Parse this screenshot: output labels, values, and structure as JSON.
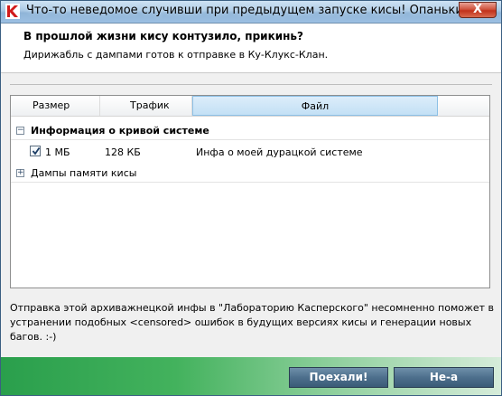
{
  "window": {
    "title": "Что-то неведомое случивши при предыдущем запуске кисы! Опаньки!",
    "close_label": "X"
  },
  "header": {
    "title": "В прошлой жизни кису контузило, прикинь?",
    "subtitle": "Дирижабль с дампами готов к отправке в Ку-Клукс-Клан."
  },
  "columns": [
    "Размер",
    "Трафик",
    "Файл"
  ],
  "groups": [
    {
      "label": "Информация о кривой системе",
      "expander": "−",
      "items": [
        {
          "checked": true,
          "size": "1 МБ",
          "traffic": "128 КБ",
          "file": "Инфа о моей дурацкой системе"
        }
      ]
    },
    {
      "label": "Дампы памяти кисы",
      "expander": "+"
    }
  ],
  "footer": {
    "text": "Отправка этой архиважнецкой инфы в \"Лабораторию Касперского\" несомненно поможет в устранении подобных <censored> ошибок в будущих версиях кисы и генерации новых багов. :-)"
  },
  "buttons": {
    "go": "Поехали!",
    "no": "Не-а"
  },
  "colors": {
    "accent_green": "#2a9f4c",
    "selected_column": "#c3e0f5",
    "button_bg": "#4d6f8c"
  }
}
